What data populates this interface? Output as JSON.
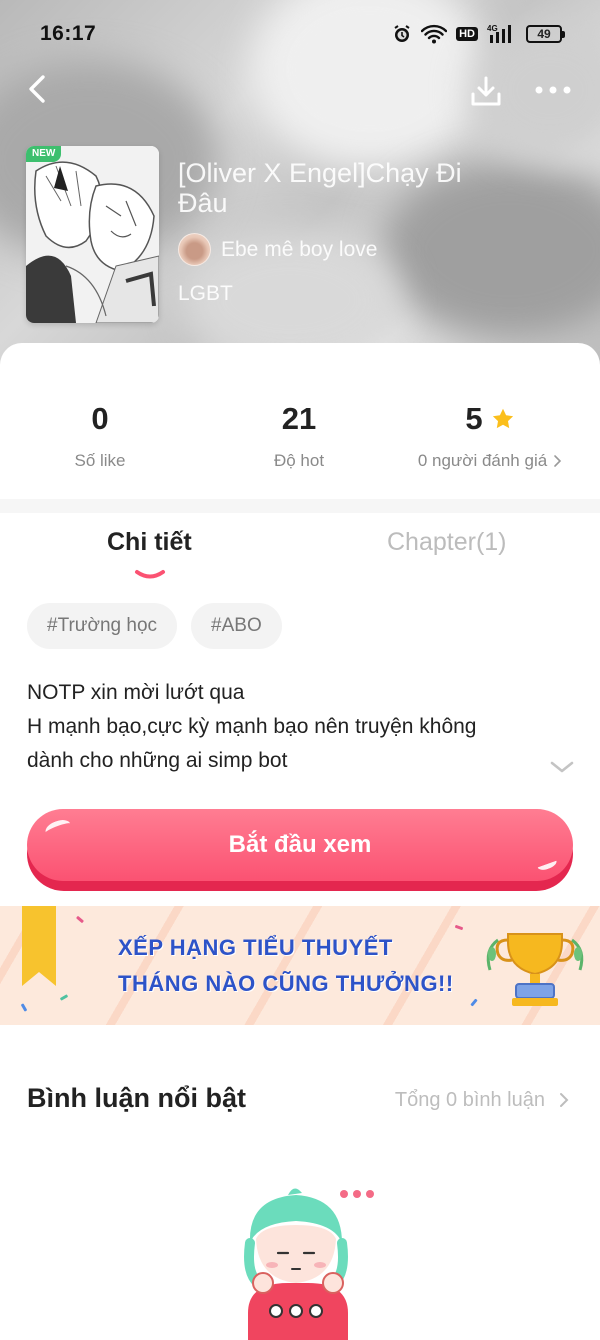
{
  "status_bar": {
    "time": "16:17",
    "network": "4G",
    "hd": "HD",
    "battery": "49"
  },
  "story": {
    "title": "[Oliver X Engel]Chạy Đi Đâu",
    "badge": "NEW",
    "author": "Ebe mê boy love",
    "status": "LGBT"
  },
  "stats": {
    "likes_value": "0",
    "likes_label": "Số like",
    "hot_value": "21",
    "hot_label": "Độ hot",
    "rating_value": "5",
    "rating_label": "0 người đánh giá"
  },
  "tabs": {
    "detail": "Chi tiết",
    "chapter": "Chapter(1)"
  },
  "tags": [
    "#Trường học",
    "#ABO"
  ],
  "description": [
    "NOTP xin mời lướt qua",
    "H mạnh bạo,cực kỳ mạnh bạo nên truyện không",
    "dành cho những ai simp bot"
  ],
  "cta": {
    "label": "Bắt đầu xem"
  },
  "banner": {
    "line1": "XẾP HẠNG TIỂU THUYẾT",
    "line2": "THÁNG NÀO CŨNG THƯỞNG!!"
  },
  "comments": {
    "title": "Bình luận nổi bật",
    "total": "Tổng 0 bình luận"
  },
  "colors": {
    "accent": "#fb5272",
    "banner_text": "#2d53c8",
    "star": "#fbbf1c"
  }
}
